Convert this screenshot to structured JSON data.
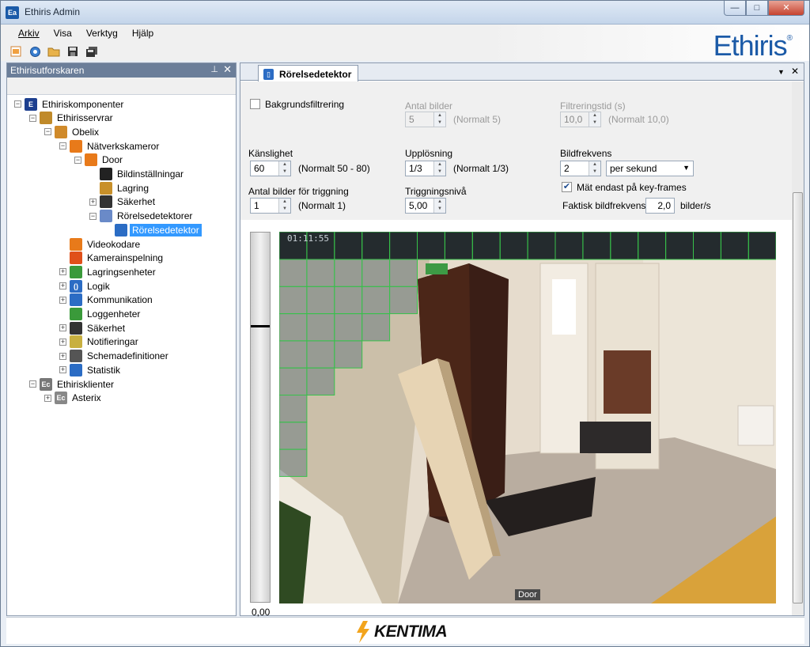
{
  "window": {
    "icon_text": "Ea",
    "title": "Ethiris Admin",
    "controls": {
      "minimize": "—",
      "maximize": "□",
      "close": "✕"
    }
  },
  "menu": [
    "Arkiv",
    "Visa",
    "Verktyg",
    "Hjälp"
  ],
  "toolbar_icons": [
    "new-icon",
    "settings-icon",
    "open-folder-icon",
    "save-icon",
    "save-all-icon"
  ],
  "brand": {
    "logo": "Ethiris",
    "mark": "®",
    "footer_logo": "KENTIMA"
  },
  "explorer": {
    "title": "Ethirisutforskaren",
    "pin": "📌",
    "close": "✕",
    "tree": [
      {
        "label": "Ethiriskomponenter",
        "icon": "E",
        "color": "#1d3f8f",
        "exp": "−"
      },
      {
        "label": "Ethirisservrar",
        "icon": "",
        "color": "#c08a2a",
        "exp": "−"
      },
      {
        "label": "Obelix",
        "icon": "",
        "color": "#d08a2a",
        "exp": "−"
      },
      {
        "label": "Nätverkskameror",
        "icon": "",
        "color": "#e87a1a",
        "exp": "−"
      },
      {
        "label": "Door",
        "icon": "",
        "color": "#e87a1a",
        "exp": "−"
      },
      {
        "label": "Bildinställningar",
        "icon": "",
        "color": "#222222",
        "exp": ""
      },
      {
        "label": "Lagring",
        "icon": "",
        "color": "#c8902a",
        "exp": ""
      },
      {
        "label": "Säkerhet",
        "icon": "",
        "color": "#333333",
        "exp": "+"
      },
      {
        "label": "Rörelsedetektorer",
        "icon": "",
        "color": "#6a8ac8",
        "exp": "−"
      },
      {
        "label": "Rörelsedetektor",
        "icon": "",
        "color": "#2b6cc4",
        "exp": ""
      },
      {
        "label": "Videokodare",
        "icon": "",
        "color": "#e87a1a",
        "exp": ""
      },
      {
        "label": "Kamerainspelning",
        "icon": "",
        "color": "#e0501a",
        "exp": ""
      },
      {
        "label": "Lagringsenheter",
        "icon": "",
        "color": "#3a9a3a",
        "exp": "+"
      },
      {
        "label": "Logik",
        "icon": "()",
        "color": "#2b6cc4",
        "exp": "+"
      },
      {
        "label": "Kommunikation",
        "icon": "",
        "color": "#2b6cc4",
        "exp": "+"
      },
      {
        "label": "Loggenheter",
        "icon": "",
        "color": "#3a9a3a",
        "exp": ""
      },
      {
        "label": "Säkerhet",
        "icon": "",
        "color": "#333333",
        "exp": "+"
      },
      {
        "label": "Notifieringar",
        "icon": "",
        "color": "#c8b040",
        "exp": "+"
      },
      {
        "label": "Schemadefinitioner",
        "icon": "",
        "color": "#555555",
        "exp": "+"
      },
      {
        "label": "Statistik",
        "icon": "",
        "color": "#2b6cc4",
        "exp": "+"
      },
      {
        "label": "Ethirisklienter",
        "icon": "Ec",
        "color": "#777777",
        "exp": "−"
      },
      {
        "label": "Asterix",
        "icon": "Ec",
        "color": "#888888",
        "exp": "+"
      }
    ]
  },
  "doc": {
    "tab_label": "Rörelsedetektor",
    "tab_menu": "▼",
    "tab_close": "✕",
    "settings": {
      "background_filter": {
        "label": "Bakgrundsfiltrering",
        "checked": false
      },
      "num_images": {
        "label": "Antal bilder",
        "value": "5",
        "hint": "(Normalt 5)"
      },
      "filter_time": {
        "label": "Filtreringstid (s)",
        "value": "10,0",
        "hint": "(Normalt 10,0)"
      },
      "sensitivity": {
        "label": "Känslighet",
        "value": "60",
        "hint": "(Normalt 50 - 80)"
      },
      "resolution": {
        "label": "Upplösning",
        "value": "1/3",
        "hint": "(Normalt 1/3)"
      },
      "frame_rate": {
        "label": "Bildfrekvens",
        "value": "2",
        "unit": "per sekund"
      },
      "trigger_images": {
        "label": "Antal bilder för triggning",
        "value": "1",
        "hint": "(Normalt 1)"
      },
      "trigger_level": {
        "label": "Triggningsnivå",
        "value": "5,00"
      },
      "keyframes": {
        "label": "Mät endast på key-frames",
        "checked": true
      },
      "actual_rate": {
        "label": "Faktisk bildfrekvens:",
        "value": "2,0",
        "unit": "bilder/s"
      }
    },
    "meter_value": "0,00",
    "camera": {
      "timestamp": "01:11:55",
      "name": "Door"
    }
  }
}
